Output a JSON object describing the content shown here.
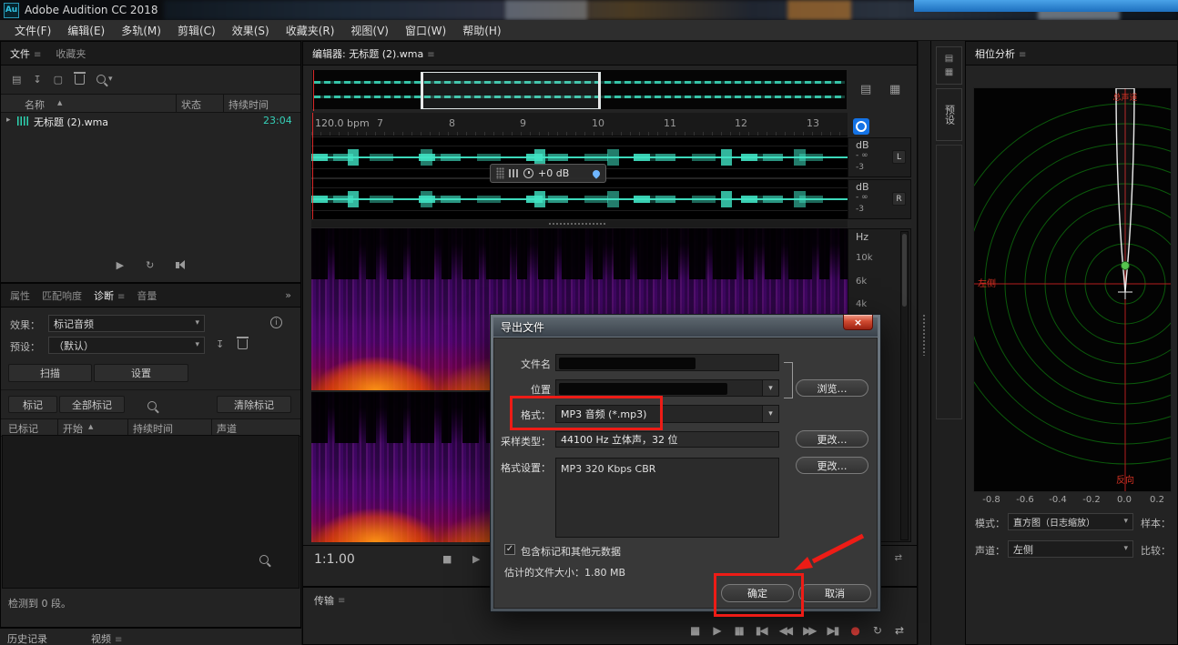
{
  "titlebar": {
    "app_initials": "Au",
    "title": "Adobe Audition CC 2018"
  },
  "menubar": {
    "items": [
      "文件(F)",
      "编辑(E)",
      "多轨(M)",
      "剪辑(C)",
      "效果(S)",
      "收藏夹(R)",
      "视图(V)",
      "窗口(W)",
      "帮助(H)"
    ]
  },
  "files_panel": {
    "tab_files": "文件",
    "tab_favorites": "收藏夹",
    "col_name": "名称",
    "col_status": "状态",
    "col_duration": "持续时间",
    "row": {
      "name": "无标题 (2).wma",
      "duration": "23:04"
    }
  },
  "diagnostics_panel": {
    "tab_properties": "属性",
    "tab_loudness": "匹配响度",
    "tab_diagnostics": "诊断",
    "tab_amplitude": "音量",
    "effect_label": "效果：",
    "effect_value": "标记音频",
    "preset_label": "预设：",
    "preset_value": "（默认）",
    "scan_button": "扫描",
    "settings_button": "设置",
    "mark_button": "标记",
    "mark_all_button": "全部标记",
    "clear_button": "清除标记",
    "col_marked": "已标记",
    "col_start": "开始",
    "col_duration": "持续时间",
    "col_channel": "声道",
    "status": "检测到 0 段。",
    "tab_history": "历史记录",
    "tab_video": "视频"
  },
  "editor": {
    "title": "编辑器: 无标题 (2).wma",
    "bpm_label": "120.0 bpm",
    "ruler_ticks": [
      "7",
      "8",
      "9",
      "10",
      "11",
      "12",
      "13"
    ],
    "hud_gain": "+0 dB",
    "db_label": "dB",
    "db_neg_inf": "- ∞",
    "db_neg3": "-3",
    "left_button": "L",
    "right_button": "R",
    "hz_label": "Hz",
    "hz_ticks": [
      "10k",
      "6k",
      "4k"
    ],
    "zoom_level": "1:1.00"
  },
  "transport_panel": {
    "title": "传输"
  },
  "side_strip": {
    "preset_tab": "预设"
  },
  "phase_panel": {
    "title": "相位分析",
    "label_top": "总声道",
    "label_left": "左侧",
    "label_bottom": "反向",
    "scale_ticks": [
      "-0.8",
      "-0.6",
      "-0.4",
      "-0.2",
      "0.0",
      "0.2"
    ],
    "mode_label": "模式：",
    "mode_value": "直方图（日志缩放）",
    "sample_label": "样本：",
    "channel_label": "声道：",
    "channel_value": "左侧",
    "compare_label": "比较："
  },
  "dialog": {
    "title": "导出文件",
    "filename_label": "文件名",
    "location_label": "位置",
    "browse_button": "浏览…",
    "format_label": "格式：",
    "format_value": "MP3 音频 (*.mp3)",
    "sample_type_label": "采样类型：",
    "sample_type_value": "44100 Hz 立体声，32 位",
    "format_settings_label": "格式设置：",
    "format_settings_value": "MP3 320 Kbps CBR",
    "change_button": "更改…",
    "include_metadata_label": "包含标记和其他元数据",
    "estimated_size": "估计的文件大小：1.80 MB",
    "ok_button": "确定",
    "cancel_button": "取消"
  },
  "icons": {
    "menu": "≡",
    "dropdown": "▾",
    "chevron": "▸",
    "sort": "▲",
    "overflow": "»",
    "close": "×",
    "check": "✓",
    "info": "i",
    "stop": "■",
    "play": "▶",
    "pause": "▮▮",
    "to_start": "▮◀",
    "rewind": "◀◀",
    "forward": "▶▶",
    "to_end": "▶▮",
    "record": "●",
    "loop": "↻",
    "swap": "⇄",
    "open": "▤",
    "import": "↧",
    "new": "▢",
    "save": "↧",
    "view_wave": "▤",
    "view_spectral": "▦",
    "left_arrow": "◀",
    "right_arrow": "▶"
  }
}
